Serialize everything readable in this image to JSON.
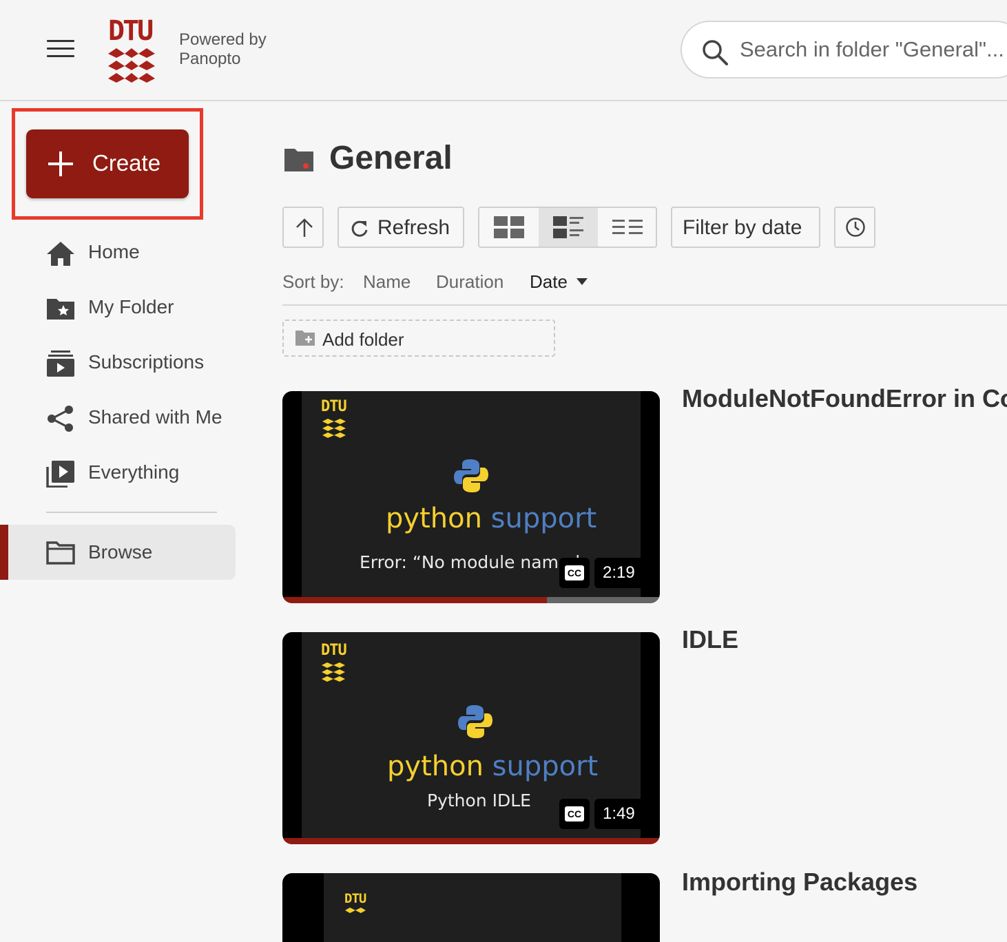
{
  "header": {
    "logo_text": "DTU",
    "powered_line1": "Powered by",
    "powered_line2": "Panopto",
    "search_placeholder": "Search in folder \"General\"..."
  },
  "sidebar": {
    "create_label": "Create",
    "items": [
      {
        "label": "Home",
        "icon": "home-icon"
      },
      {
        "label": "My Folder",
        "icon": "star-folder-icon"
      },
      {
        "label": "Subscriptions",
        "icon": "subscriptions-icon"
      },
      {
        "label": "Shared with Me",
        "icon": "share-icon"
      },
      {
        "label": "Everything",
        "icon": "video-library-icon"
      }
    ],
    "browse_label": "Browse"
  },
  "main": {
    "folder_name": "General",
    "toolbar": {
      "refresh_label": "Refresh",
      "filter_label": "Filter by date"
    },
    "sort": {
      "label": "Sort by:",
      "options": [
        "Name",
        "Duration",
        "Date"
      ],
      "active": "Date"
    },
    "add_folder_label": "Add folder",
    "videos": [
      {
        "title": "ModuleNotFoundError in Co",
        "thumb_logo": "DTU",
        "thumb_word1": "python",
        "thumb_word2": "support",
        "thumb_subtitle": "Error: “No module named",
        "cc": "CC",
        "duration": "2:19",
        "watched_fraction": 0.7
      },
      {
        "title": "IDLE",
        "thumb_logo": "DTU",
        "thumb_word1": "python",
        "thumb_word2": "support",
        "thumb_subtitle": "Python IDLE",
        "cc": "CC",
        "duration": "1:49",
        "watched_fraction": 1.0
      },
      {
        "title": "Importing Packages",
        "thumb_logo": "DTU"
      }
    ]
  },
  "colors": {
    "brand_red": "#8f1b12",
    "highlight": "#e8392c",
    "python_yellow": "#f5d02f",
    "python_blue": "#4f7fc4"
  }
}
